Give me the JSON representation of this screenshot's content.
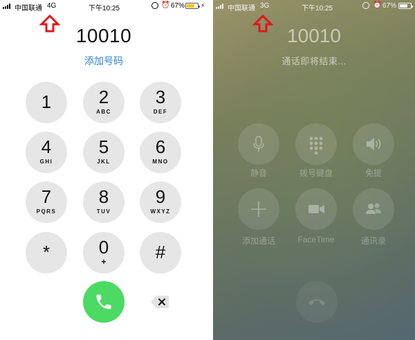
{
  "colors": {
    "accent_link": "#2f84d6",
    "call_green": "#4cd964",
    "key_gray": "#e6e6e6",
    "arrow_red": "#e0161b"
  },
  "left": {
    "status_bar": {
      "carrier": "中国联通",
      "network": "4G",
      "time": "下午10:25",
      "battery": "67%",
      "battery_level": 0.67,
      "icons": [
        "signal-icon",
        "orientation-lock-icon",
        "alarm-icon",
        "battery-icon",
        "charging-bolt-icon"
      ]
    },
    "number": "10010",
    "add_contact": "添加号码",
    "keypad": [
      {
        "digit": "1",
        "letters": ""
      },
      {
        "digit": "2",
        "letters": "ABC"
      },
      {
        "digit": "3",
        "letters": "DEF"
      },
      {
        "digit": "4",
        "letters": "GHI"
      },
      {
        "digit": "5",
        "letters": "JKL"
      },
      {
        "digit": "6",
        "letters": "MNO"
      },
      {
        "digit": "7",
        "letters": "PQRS"
      },
      {
        "digit": "8",
        "letters": "TUV"
      },
      {
        "digit": "9",
        "letters": "WXYZ"
      },
      {
        "digit": "*",
        "letters": ""
      },
      {
        "digit": "0",
        "letters": "+"
      },
      {
        "digit": "#",
        "letters": ""
      }
    ],
    "call_icon": "phone-icon",
    "delete_icon": "backspace-icon"
  },
  "right": {
    "status_bar": {
      "carrier": "中国联通",
      "network": "3G",
      "time": "下午10:25",
      "battery": "67%",
      "battery_level": 0.67,
      "icons": [
        "signal-icon",
        "orientation-lock-icon",
        "alarm-icon",
        "battery-icon"
      ]
    },
    "number": "10010",
    "call_status": "通话即将结束...",
    "controls": [
      {
        "label": "静音",
        "icon": "mute-microphone-icon"
      },
      {
        "label": "拨号键盘",
        "icon": "keypad-icon"
      },
      {
        "label": "免提",
        "icon": "speaker-icon"
      },
      {
        "label": "添加通话",
        "icon": "plus-icon"
      },
      {
        "label": "FaceTime",
        "icon": "video-camera-icon"
      },
      {
        "label": "通讯录",
        "icon": "contacts-icon"
      }
    ],
    "end_icon": "end-call-icon"
  },
  "annotation_icon": "up-arrow-icon"
}
